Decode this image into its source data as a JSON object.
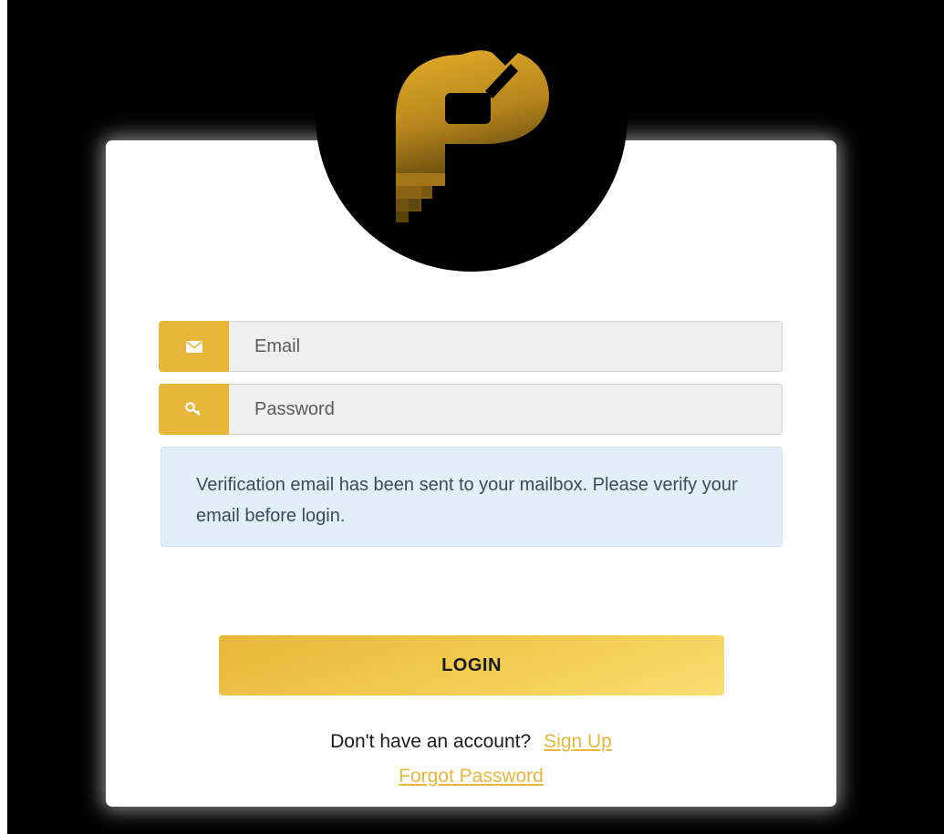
{
  "brand": {
    "logo_icon": "p-logo-icon",
    "accent_color": "#e8b63a"
  },
  "form": {
    "email": {
      "icon": "envelope-icon",
      "placeholder": "Email",
      "value": ""
    },
    "password": {
      "icon": "key-icon",
      "placeholder": "Password",
      "value": ""
    }
  },
  "alert": {
    "message": "Verification email has been sent to your mailbox. Please verify your email before login."
  },
  "login_button": {
    "label": "LOGIN"
  },
  "footer": {
    "no_account_text": "Don't have an account?",
    "signup_link": "Sign Up",
    "forgot_link": "Forgot Password"
  }
}
